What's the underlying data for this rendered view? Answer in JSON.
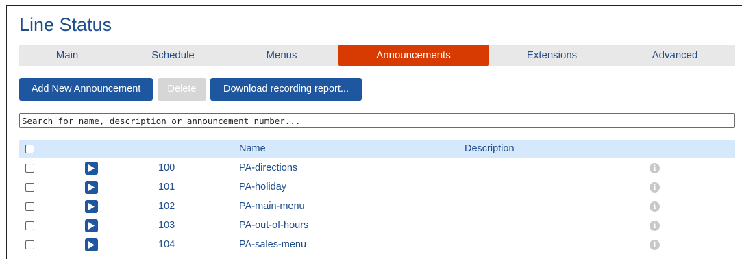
{
  "page": {
    "title": "Line Status"
  },
  "tabs": [
    "Main",
    "Schedule",
    "Menus",
    "Announcements",
    "Extensions",
    "Advanced"
  ],
  "active_tab": "Announcements",
  "colors": {
    "accent": "#d83b01",
    "primary": "#1e56a0",
    "header_bg": "#d6e8fb",
    "tab_bar_bg": "#e8e8e8"
  },
  "toolbar": {
    "add_label": "Add New Announcement",
    "delete_label": "Delete",
    "download_label": "Download recording report..."
  },
  "search": {
    "placeholder": "Search for name, description or announcement number...",
    "value": ""
  },
  "table": {
    "headers": {
      "name": "Name",
      "description": "Description"
    },
    "rows": [
      {
        "number": "100",
        "name": "PA-directions",
        "description": ""
      },
      {
        "number": "101",
        "name": "PA-holiday",
        "description": ""
      },
      {
        "number": "102",
        "name": "PA-main-menu",
        "description": ""
      },
      {
        "number": "103",
        "name": "PA-out-of-hours",
        "description": ""
      },
      {
        "number": "104",
        "name": "PA-sales-menu",
        "description": ""
      }
    ],
    "row_icons": {
      "play": "play-icon",
      "info": "info-icon"
    }
  }
}
